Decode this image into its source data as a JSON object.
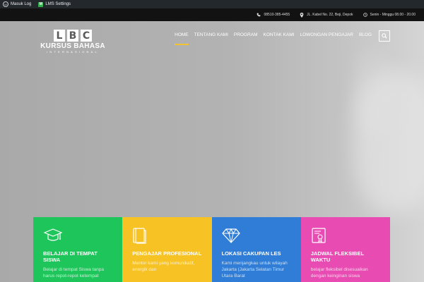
{
  "adminbar": {
    "login_label": "Masuk Log",
    "lms_label": "LMS Settings"
  },
  "infobar": {
    "phone": "08510-385-4455",
    "address": "JL. Kabel No. 22, Beji, Depok",
    "hours": "Senin - Minggu 08.00 - 20.00"
  },
  "logo": {
    "letters": [
      "L",
      "B",
      "C"
    ],
    "brand": "KURSUS BAHASA",
    "sub": "INTERNASIONAL"
  },
  "nav": {
    "items": [
      "HOME",
      "TENTANG KAMI",
      "PROGRAM",
      "KONTAK KAMI",
      "LOWONGAN PENGAJAR",
      "BLOG"
    ],
    "active_index": 0,
    "accent": "#f1c232"
  },
  "cards": [
    {
      "title": "BELAJAR DI TEMPAT SISWA",
      "desc": "Belajar di tempat Siswa tanpa harus repot-repot ketempat",
      "color": "#1ec55a",
      "icon": "graduation-cap-icon"
    },
    {
      "title": "PENGAJAR PROFESIONAL",
      "desc": "Mentor kami yang komunikatif, energik dan",
      "color": "#f7c223",
      "icon": "book-icon"
    },
    {
      "title": "LOKASI CAKUPAN LES",
      "desc": "Kami menjangkau untuk wilayah Jakarta (Jakarta Selatan Timur Utara Barat",
      "color": "#2f7dd6",
      "icon": "diamond-icon"
    },
    {
      "title": "JADWAL FLEKSIBEL Waktu",
      "desc": "belajar fleksibel disesuaikan dengan keinginan siswa",
      "color": "#e84cb3",
      "icon": "certificate-icon"
    }
  ]
}
